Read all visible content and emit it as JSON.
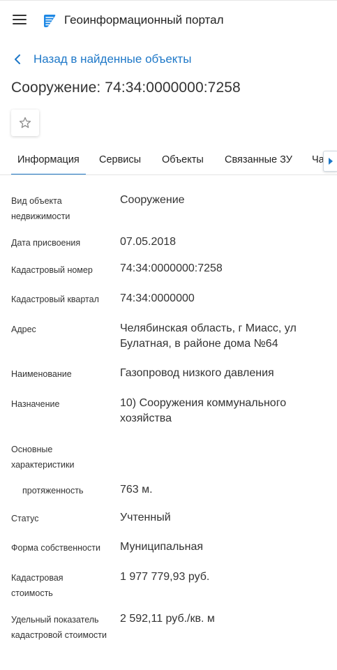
{
  "header": {
    "title": "Геоинформационный портал",
    "menu_icon": "hamburger-menu-icon",
    "logo_icon": "geo-portal-logo-icon",
    "logo_color": "#1e88e5"
  },
  "back_link": {
    "label": "Назад в найденные объекты",
    "icon": "chevron-left-icon"
  },
  "page_title": "Сооружение: 74:34:0000000:7258",
  "favorite": {
    "icon": "star-outline-icon"
  },
  "tabs": [
    {
      "label": "Информация",
      "active": true
    },
    {
      "label": "Сервисы",
      "active": false
    },
    {
      "label": "Объекты",
      "active": false
    },
    {
      "label": "Связанные ЗУ",
      "active": false
    },
    {
      "label": "Ча",
      "active": false
    }
  ],
  "tabs_scroll_icon": "caret-right-icon",
  "details": {
    "object_type": {
      "label": "Вид объекта недвижимости",
      "value": "Сооружение"
    },
    "assign_date": {
      "label": "Дата присвоения",
      "value": "07.05.2018"
    },
    "cadastral_number": {
      "label": "Кадастровый номер",
      "value": "74:34:0000000:7258"
    },
    "cadastral_quarter": {
      "label": "Кадастровый квартал",
      "value": "74:34:0000000"
    },
    "address": {
      "label": "Адрес",
      "value": "Челябинская область, г Миасс, ул Булатная, в районе дома №64"
    },
    "name": {
      "label": "Наименование",
      "value": "Газопровод низкого давления"
    },
    "purpose": {
      "label": "Назначение",
      "value": "10) Сооружения коммунального хозяйства"
    },
    "characteristics": {
      "label": "Основные характеристики"
    },
    "length": {
      "label": "протяженность",
      "value": "763 м."
    },
    "status": {
      "label": "Статус",
      "value": "Учтенный"
    },
    "ownership": {
      "label": "Форма собственности",
      "value": "Муниципальная"
    },
    "cadastral_cost": {
      "label": "Кадастровая стоимость",
      "value": "1 977 779,93 руб."
    },
    "unit_cost": {
      "label": "Удельный показатель кадастровой стоимости",
      "value": "2 592,11 руб./кв. м"
    }
  },
  "colors": {
    "accent": "#1e78c8",
    "text": "#333333"
  }
}
